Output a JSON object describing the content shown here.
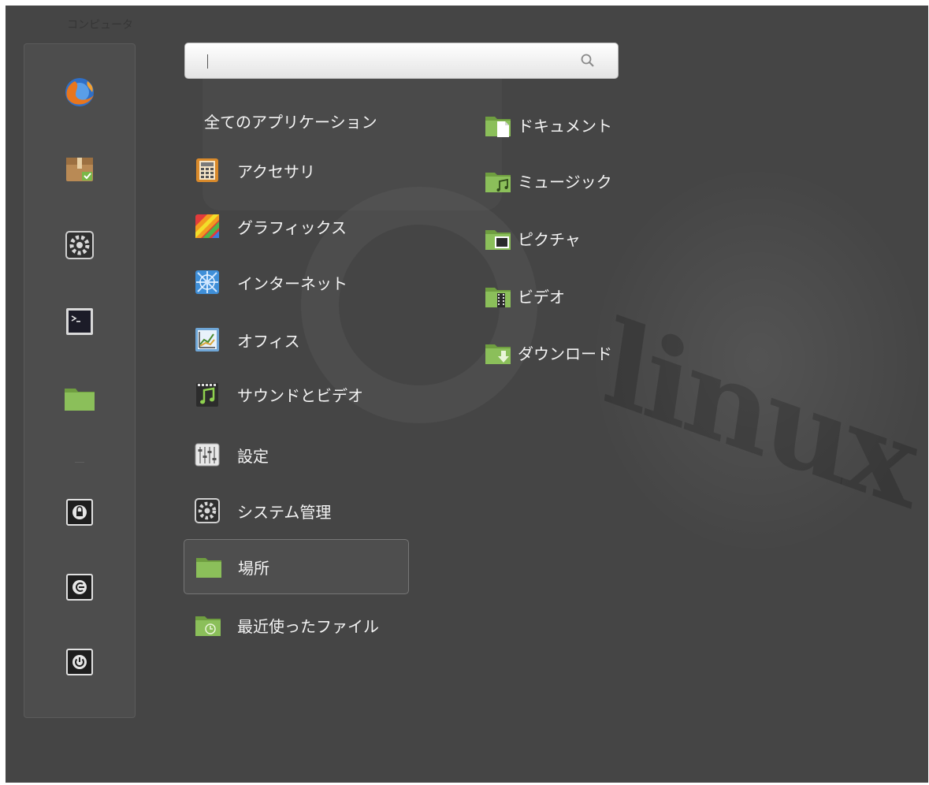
{
  "window": {
    "faint_title": "コンピュータ"
  },
  "search": {
    "value": "",
    "placeholder": ""
  },
  "favorites": [
    {
      "name": "firefox",
      "icon": "firefox-icon"
    },
    {
      "name": "software-manager",
      "icon": "package-icon"
    },
    {
      "name": "system-settings",
      "icon": "gear-icon"
    },
    {
      "name": "terminal",
      "icon": "terminal-icon"
    },
    {
      "name": "files",
      "icon": "folder-icon"
    },
    {
      "name": "lock-screen",
      "icon": "lock-icon"
    },
    {
      "name": "logout",
      "icon": "logout-icon"
    },
    {
      "name": "shutdown",
      "icon": "power-icon"
    }
  ],
  "categories": [
    {
      "label": "全てのアプリケーション",
      "icon": "none"
    },
    {
      "label": "アクセサリ",
      "icon": "calculator-icon"
    },
    {
      "label": "グラフィックス",
      "icon": "graphics-icon"
    },
    {
      "label": "インターネット",
      "icon": "internet-icon"
    },
    {
      "label": "オフィス",
      "icon": "office-icon"
    },
    {
      "label": "サウンドとビデオ",
      "icon": "music-icon"
    },
    {
      "label": "設定",
      "icon": "settings-icon"
    },
    {
      "label": "システム管理",
      "icon": "system-icon"
    },
    {
      "label": "場所",
      "icon": "folder-icon",
      "selected": true
    },
    {
      "label": "最近使ったファイル",
      "icon": "recent-folder-icon"
    }
  ],
  "places": [
    {
      "label": "ドキュメント",
      "icon": "documents-folder-icon"
    },
    {
      "label": "ミュージック",
      "icon": "music-folder-icon"
    },
    {
      "label": "ピクチャ",
      "icon": "pictures-folder-icon"
    },
    {
      "label": "ビデオ",
      "icon": "videos-folder-icon"
    },
    {
      "label": "ダウンロード",
      "icon": "downloads-folder-icon"
    }
  ],
  "colors": {
    "panel_bg": "#454545",
    "folder_green": "#8bbf5a",
    "selected_border": "#767676"
  }
}
